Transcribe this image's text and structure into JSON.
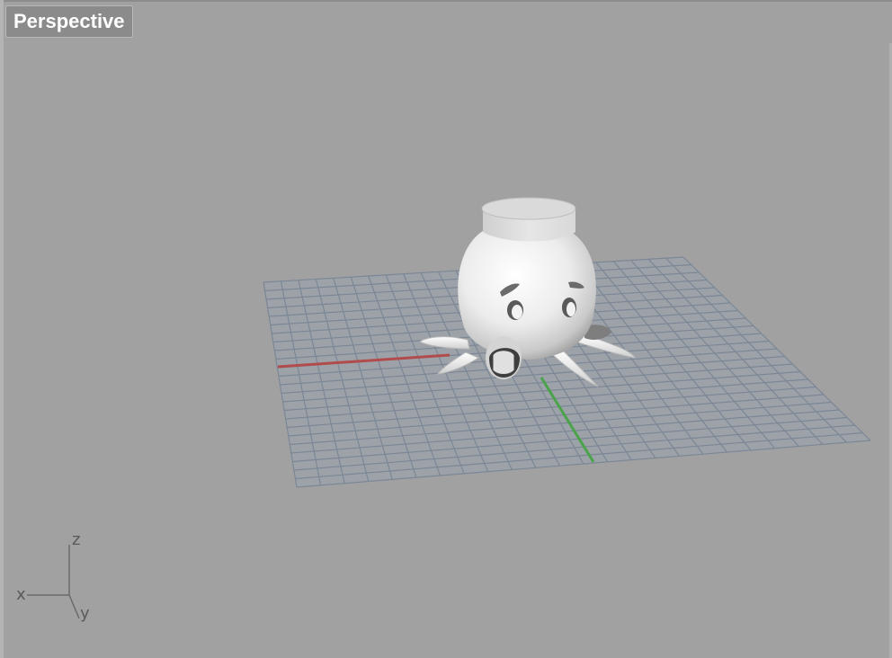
{
  "viewport": {
    "title": "Perspective"
  },
  "axis_widget": {
    "x_label": "x",
    "y_label": "y",
    "z_label": "z"
  },
  "colors": {
    "background": "#a1a1a1",
    "grid_line": "#7b8796",
    "x_axis": "#b24b4b",
    "y_axis": "#4aa34a",
    "model": "#e9e9e9"
  },
  "model": {
    "name": "octopus"
  }
}
